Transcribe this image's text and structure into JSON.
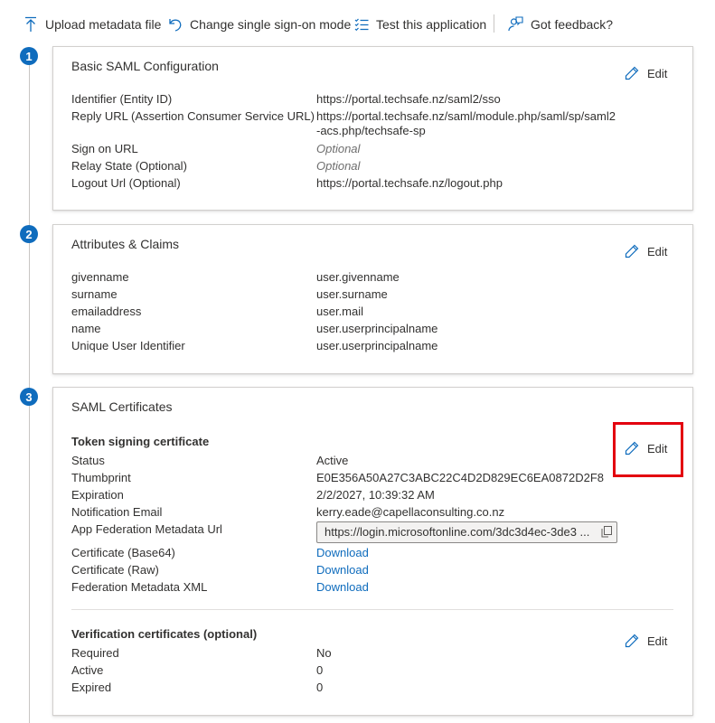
{
  "toolbar": {
    "upload_metadata": "Upload metadata file",
    "change_sso": "Change single sign-on mode",
    "test_app": "Test this application",
    "feedback": "Got feedback?"
  },
  "edit_label": "Edit",
  "steps": [
    "1",
    "2",
    "3"
  ],
  "basic_saml": {
    "title": "Basic SAML Configuration",
    "rows": [
      {
        "label": "Identifier (Entity ID)",
        "value": "https://portal.techsafe.nz/saml2/sso"
      },
      {
        "label": "Reply URL (Assertion Consumer Service URL)",
        "value": "https://portal.techsafe.nz/saml/module.php/saml/sp/saml2-acs.php/techsafe-sp"
      },
      {
        "label": "Sign on URL",
        "value": "Optional"
      },
      {
        "label": "Relay State (Optional)",
        "value": "Optional"
      },
      {
        "label": "Logout Url (Optional)",
        "value": "https://portal.techsafe.nz/logout.php"
      }
    ]
  },
  "attributes": {
    "title": "Attributes & Claims",
    "rows": [
      {
        "label": "givenname",
        "value": "user.givenname"
      },
      {
        "label": "surname",
        "value": "user.surname"
      },
      {
        "label": "emailaddress",
        "value": "user.mail"
      },
      {
        "label": "name",
        "value": "user.userprincipalname"
      },
      {
        "label": "Unique User Identifier",
        "value": "user.userprincipalname"
      }
    ]
  },
  "certificates": {
    "title": "SAML Certificates",
    "token_heading": "Token signing certificate",
    "status": {
      "label": "Status",
      "value": "Active"
    },
    "thumbprint": {
      "label": "Thumbprint",
      "value": "E0E356A50A27C3ABC22C4D2D829EC6EA0872D2F8"
    },
    "expiration": {
      "label": "Expiration",
      "value": "2/2/2027, 10:39:32 AM"
    },
    "notification": {
      "label": "Notification Email",
      "value": "kerry.eade@capellaconsulting.co.nz"
    },
    "metadata_url": {
      "label": "App Federation Metadata Url",
      "value": "https://login.microsoftonline.com/3dc3d4ec-3de3 ..."
    },
    "cert_base64": {
      "label": "Certificate (Base64)",
      "value": "Download"
    },
    "cert_raw": {
      "label": "Certificate (Raw)",
      "value": "Download"
    },
    "fed_xml": {
      "label": "Federation Metadata XML",
      "value": "Download"
    },
    "verification_heading": "Verification certificates (optional)",
    "required": {
      "label": "Required",
      "value": "No"
    },
    "active": {
      "label": "Active",
      "value": "0"
    },
    "expired": {
      "label": "Expired",
      "value": "0"
    }
  },
  "colors": {
    "accent": "#0f6cbd",
    "highlight": "#e3000f",
    "text": "#323130"
  }
}
